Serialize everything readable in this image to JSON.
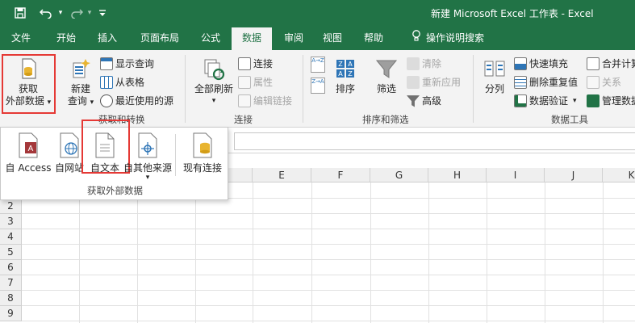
{
  "window": {
    "title": "新建 Microsoft Excel 工作表  -  Excel"
  },
  "quick_access": {
    "save_icon": "save-icon",
    "undo_icon": "undo-icon",
    "redo_icon": "redo-icon",
    "customize_icon": "customize-icon"
  },
  "tabs": [
    {
      "label": "文件"
    },
    {
      "label": "开始"
    },
    {
      "label": "插入"
    },
    {
      "label": "页面布局"
    },
    {
      "label": "公式"
    },
    {
      "label": "数据",
      "active": true
    },
    {
      "label": "审阅"
    },
    {
      "label": "视图"
    },
    {
      "label": "帮助"
    },
    {
      "label": "操作说明搜索"
    }
  ],
  "ribbon": {
    "get_external_data": {
      "line1": "获取",
      "line2": "外部数据",
      "arrow": "▾"
    },
    "new_query": {
      "line1": "新建",
      "line2": "查询",
      "arrow": "▾"
    },
    "show_queries": "显示查询",
    "from_table": "从表格",
    "recent_sources": "最近使用的源",
    "group_get_transform": "获取和转换",
    "refresh_all": {
      "line1": "全部刷新",
      "arrow": "▾"
    },
    "connections": "连接",
    "properties": "属性",
    "edit_links": "编辑链接",
    "group_connections": "连接",
    "sort_az_icon": "A→Z",
    "sort_za_icon": "Z→A",
    "sort": "排序",
    "filter": "筛选",
    "clear": "清除",
    "reapply": "重新应用",
    "advanced": "高级",
    "group_sort_filter": "排序和筛选",
    "split_column": "分列",
    "flash_fill": "快速填充",
    "remove_duplicates": "删除重复值",
    "data_validation": "数据验证",
    "validation_arrow": "▾",
    "consolidate": "合并计算",
    "relationships": "关系",
    "manage_model": "管理数据",
    "group_data_tools": "数据工具"
  },
  "dropdown": {
    "items": [
      {
        "label": "自 Access"
      },
      {
        "label": "自网站"
      },
      {
        "label": "自文本"
      },
      {
        "label": "自其他来源"
      },
      {
        "label": "现有连接"
      }
    ],
    "other_sources_arrow": "▾",
    "group_label": "获取外部数据"
  },
  "grid": {
    "columns": [
      "E",
      "F",
      "G",
      "H",
      "I",
      "J",
      "K"
    ],
    "rows": [
      "2",
      "3",
      "4",
      "5",
      "6",
      "7",
      "8",
      "9"
    ]
  },
  "colors": {
    "excel_green": "#217346",
    "highlight_red": "#e53935"
  }
}
